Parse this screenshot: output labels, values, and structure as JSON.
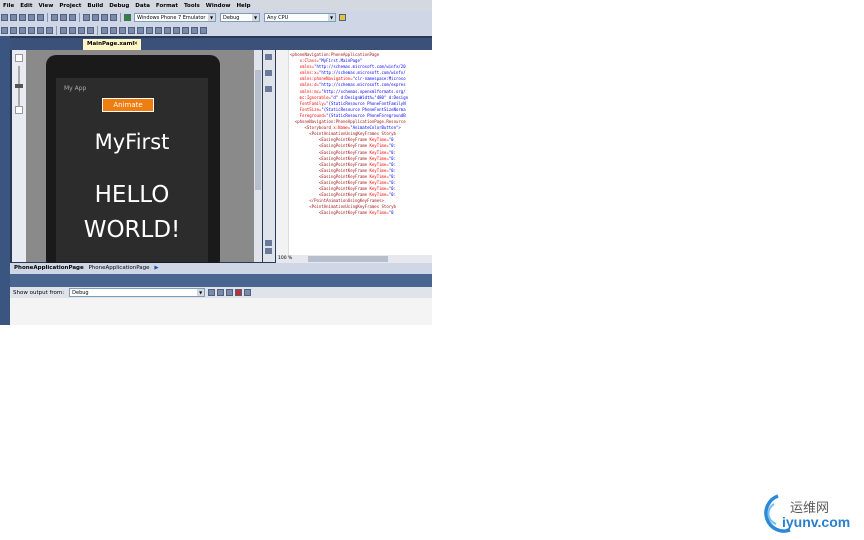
{
  "menu": [
    "File",
    "Edit",
    "View",
    "Project",
    "Build",
    "Debug",
    "Data",
    "Format",
    "Tools",
    "Window",
    "Help"
  ],
  "toolbar": {
    "target_device": "Windows Phone 7 Emulator",
    "configuration": "Debug",
    "platform": "Any CPU"
  },
  "tabs": {
    "inactive": "",
    "active": "MainPage.xaml"
  },
  "designer": {
    "app_name": "My App",
    "animate_button": "Animate",
    "page_title": "MyFirst",
    "hello_line1": "HELLO",
    "hello_line2": "WORLD!"
  },
  "xaml_lines": [
    {
      "pre": "",
      "tag": "<phoneNavigation:PhoneApplicationPage",
      "rest": ""
    },
    {
      "pre": "    ",
      "attr": "x:Class=",
      "val": "\"MyFirst.MainPage\""
    },
    {
      "pre": "    ",
      "attr": "xmlns=",
      "val": "\"http://schemas.microsoft.com/winfx/20"
    },
    {
      "pre": "    ",
      "attr": "xmlns:x=",
      "val": "\"http://schemas.microsoft.com/winfx/"
    },
    {
      "pre": "    ",
      "attr": "xmlns:phoneNavigation=",
      "val": "\"clr-namespace:Microso"
    },
    {
      "pre": "    ",
      "attr": "xmlns:d=",
      "val": "\"http://schemas.microsoft.com/expres"
    },
    {
      "pre": "    ",
      "attr": "xmlns:mc=",
      "val": "\"http://schemas.openxmlformats.org/"
    },
    {
      "pre": "    ",
      "attr": "mc:Ignorable=",
      "val": "\"d\" d:DesignWidth=\"480\" d:Design"
    },
    {
      "pre": "    ",
      "attr": "FontFamily=",
      "val": "\"{StaticResource PhoneFontFamilyN"
    },
    {
      "pre": "    ",
      "attr": "FontSize=",
      "val": "\"{StaticResource PhoneFontSizeNorma"
    },
    {
      "pre": "    ",
      "attr": "Foreground=",
      "val": "\"{StaticResource PhoneForegroundB"
    },
    {
      "pre": "  ",
      "tag": "<phoneNavigation:PhoneApplicationPage.Resource"
    },
    {
      "pre": "      ",
      "tag": "<Storyboard ",
      "attr": "x:Name=",
      "val": "\"AnimateColorButton\">"
    },
    {
      "pre": "        ",
      "tag": "<PointAnimationUsingKeyFrames Storyb"
    },
    {
      "pre": "            ",
      "tag": "<EasingPointKeyFrame ",
      "attr": "KeyTime=",
      "val": "\"0"
    },
    {
      "pre": "            ",
      "tag": "<EasingPointKeyFrame ",
      "attr": "KeyTime=",
      "val": "\"0:"
    },
    {
      "pre": "            ",
      "tag": "<EasingPointKeyFrame ",
      "attr": "KeyTime=",
      "val": "\"0:"
    },
    {
      "pre": "            ",
      "tag": "<EasingPointKeyFrame ",
      "attr": "KeyTime=",
      "val": "\"0:"
    },
    {
      "pre": "            ",
      "tag": "<EasingPointKeyFrame ",
      "attr": "KeyTime=",
      "val": "\"0:"
    },
    {
      "pre": "            ",
      "tag": "<EasingPointKeyFrame ",
      "attr": "KeyTime=",
      "val": "\"0:"
    },
    {
      "pre": "            ",
      "tag": "<EasingPointKeyFrame ",
      "attr": "KeyTime=",
      "val": "\"0:"
    },
    {
      "pre": "            ",
      "tag": "<EasingPointKeyFrame ",
      "attr": "KeyTime=",
      "val": "\"0:"
    },
    {
      "pre": "            ",
      "tag": "<EasingPointKeyFrame ",
      "attr": "KeyTime=",
      "val": "\"0:"
    },
    {
      "pre": "            ",
      "tag": "<EasingPointKeyFrame ",
      "attr": "KeyTime=",
      "val": "\"0:"
    },
    {
      "pre": "        ",
      "tag": "</PointAnimationUsingKeyFrames>"
    },
    {
      "pre": "        ",
      "tag": "<PointAnimationUsingKeyFrames Storyb"
    },
    {
      "pre": "            ",
      "tag": "<EasingPointKeyFrame ",
      "attr": "KeyTime=",
      "val": "\"0"
    }
  ],
  "zoom": "100 %",
  "breadcrumb": {
    "root": "PhoneApplicationPage",
    "child": "PhoneApplicationPage"
  },
  "output": {
    "label": "Show output from:",
    "source": "Debug"
  },
  "watermark": {
    "cn": "运维网",
    "url": "iyunv.com"
  }
}
